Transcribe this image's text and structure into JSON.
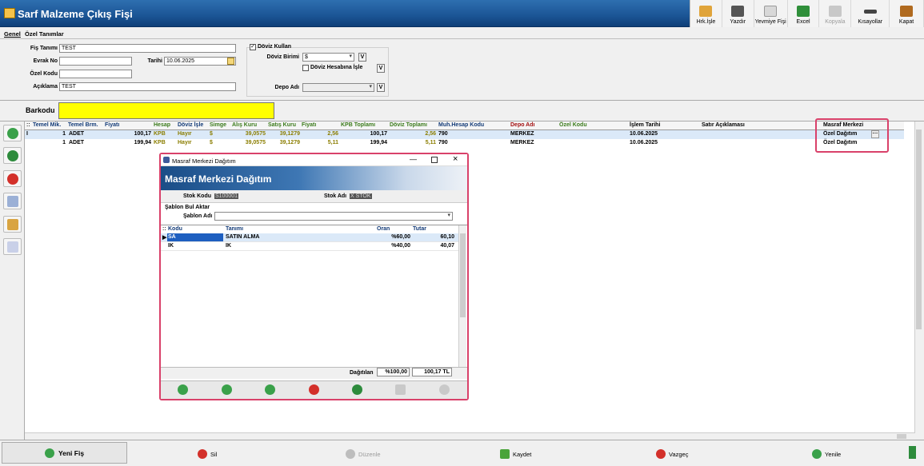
{
  "window": {
    "title": "Sarf Malzeme Çıkış Fişi"
  },
  "toolbar": {
    "items": [
      "Hrk.İşle",
      "Yazdır",
      "Yevmiye Fişi",
      "Excel",
      "Kopyala",
      "Kısayollar",
      "Kapat"
    ]
  },
  "tabs": [
    "Genel",
    "Özel Tanımlar"
  ],
  "form": {
    "fis_tanimi_label": "Fiş Tanımı",
    "fis_tanimi": "TEST",
    "evrak_no_label": "Evrak No",
    "evrak_no": "",
    "tarihi_label": "Tarihi",
    "tarihi": "10.06.2025",
    "ozel_kodu_label": "Özel Kodu",
    "ozel_kodu": "",
    "aciklama_label": "Açıklama",
    "aciklama": "TEST",
    "doviz_kullan_label": "Döviz Kullan",
    "doviz_kullan_check": "✓",
    "doviz_birimi_label": "Döviz Birimi",
    "doviz_birimi": "$",
    "doviz_hesabina_label": "Döviz Hesabına İşle",
    "depo_adi_label": "Depo Adı",
    "depo_adi": "",
    "v_label": "V"
  },
  "barcode": {
    "label": "Barkodu"
  },
  "grid": {
    "columns": [
      "Temel Mik.",
      "Temel Brm.",
      "Fiyatı",
      "Hesap",
      "Döviz İşle",
      "Simge",
      "Alış Kuru",
      "Satış Kuru",
      "Fiyatı",
      "KPB Toplamı",
      "Döviz Toplamı",
      "Muh.Hesap Kodu",
      "Depo Adı",
      "Özel Kodu",
      "İşlem Tarihi",
      "Satır Açıklaması",
      "Masraf Merkezi"
    ],
    "rows": [
      {
        "mik": "1",
        "brm": "ADET",
        "fiyat": "100,17",
        "hesap": "KPB",
        "doviz_isle": "Hayır",
        "simge": "$",
        "alis": "39,0575",
        "satis": "39,1279",
        "fiyat2": "2,56",
        "kpb": "100,17",
        "doviz": "2,56",
        "muh": "790",
        "depo": "MERKEZ",
        "ozel": "",
        "tarih": "10.06.2025",
        "aciklama": "",
        "masraf": "Özel Dağıtım",
        "masraf_btn": "···"
      },
      {
        "mik": "1",
        "brm": "ADET",
        "fiyat": "199,94",
        "hesap": "KPB",
        "doviz_isle": "Hayır",
        "simge": "$",
        "alis": "39,0575",
        "satis": "39,1279",
        "fiyat2": "5,11",
        "kpb": "199,94",
        "doviz": "5,11",
        "muh": "790",
        "depo": "MERKEZ",
        "ozel": "",
        "tarih": "10.06.2025",
        "aciklama": "",
        "masraf": "Özel Dağıtım"
      }
    ]
  },
  "bottom": {
    "yeni_fis": "Yeni Fiş",
    "sil": "Sil",
    "duzenle": "Düzenle",
    "kaydet": "Kaydet",
    "vazgec": "Vazgeç",
    "yenile": "Yenile"
  },
  "dialog": {
    "title": "Masraf Merkezi Dağıtım",
    "header": "Masraf Merkezi Dağıtım",
    "stok_kodu_label": "Stok Kodu",
    "stok_kodu": "S100001",
    "stok_adi_label": "Stok Adı",
    "stok_adi": "X STOK",
    "sablon_section": "Şablon Bul Aktar",
    "sablon_adi_label": "Şablon Adı",
    "sablon_adi": "",
    "columns": [
      "Kodu",
      "Tanımı",
      "Oran",
      "Tutar"
    ],
    "rows": [
      {
        "kodu": "SA",
        "tanimi": "SATIN ALMA",
        "oran": "%60,00",
        "tutar": "60,10"
      },
      {
        "kodu": "IK",
        "tanimi": "IK",
        "oran": "%40,00",
        "tutar": "40,07"
      }
    ],
    "dagitilan_label": "Dağıtılan",
    "dagitilan_oran": "%100,00",
    "dagitilan_tutar": "100,17 TL"
  },
  "colors": {
    "accent": "#1b5595",
    "highlight": "#d9416a",
    "barcode": "#ffff00"
  }
}
